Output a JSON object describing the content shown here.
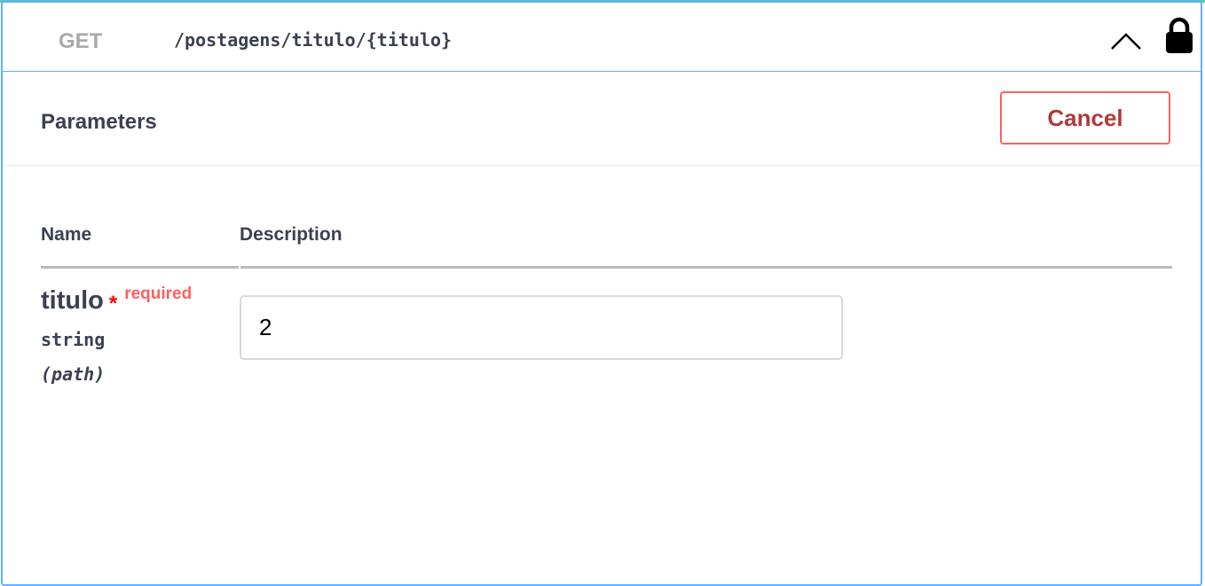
{
  "operation": {
    "method": "GET",
    "path": "/postagens/titulo/{titulo}"
  },
  "icons": {
    "collapse": "chevron-up-icon",
    "auth": "lock-icon"
  },
  "parameters": {
    "title": "Parameters",
    "cancel_label": "Cancel",
    "columns": {
      "name": "Name",
      "description": "Description"
    },
    "items": [
      {
        "name": "titulo",
        "required_star": "*",
        "required_label": "required",
        "type": "string",
        "in": "(path)",
        "value": "2"
      }
    ]
  },
  "colors": {
    "get_border": "#61affe",
    "cancel_border": "#ff6060",
    "cancel_text": "#b03a3a",
    "required": "#ff0000",
    "text": "#3b4151"
  }
}
